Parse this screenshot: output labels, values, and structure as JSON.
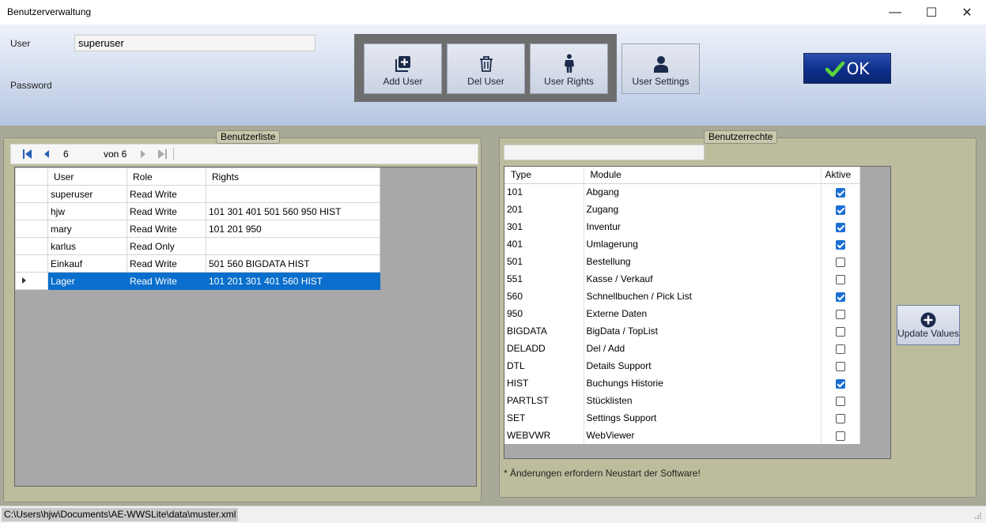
{
  "window": {
    "title": "Benutzerverwaltung",
    "minimize": "—",
    "maximize": "☐",
    "close": "✕"
  },
  "login": {
    "user_label": "User",
    "user_value": "superuser",
    "password_label": "Password"
  },
  "toolbar": {
    "add_user": "Add User",
    "del_user": "Del User",
    "user_rights": "User Rights",
    "user_settings": "User Settings",
    "ok": "OK"
  },
  "userlist": {
    "group_label": "Benutzerliste",
    "nav": {
      "position": "6",
      "of_label": "von 6"
    },
    "columns": [
      "User",
      "Role",
      "Rights"
    ],
    "rows": [
      {
        "user": "superuser",
        "role": "Read Write",
        "rights": ""
      },
      {
        "user": "hjw",
        "role": "Read Write",
        "rights": "101 301 401 501 560 950 HIST"
      },
      {
        "user": "mary",
        "role": "Read Write",
        "rights": "101 201 950"
      },
      {
        "user": "karlus",
        "role": "Read Only",
        "rights": ""
      },
      {
        "user": "Einkauf",
        "role": "Read Write",
        "rights": "501 560 BIGDATA HIST"
      },
      {
        "user": "Lager",
        "role": "Read Write",
        "rights": "101 201 301 401 560 HIST"
      }
    ]
  },
  "rights": {
    "group_label": "Benutzerrechte",
    "columns": [
      "Type",
      "Module",
      "Aktive"
    ],
    "rows": [
      {
        "type": "101",
        "module": "Abgang",
        "active": true
      },
      {
        "type": "201",
        "module": "Zugang",
        "active": true
      },
      {
        "type": "301",
        "module": "Inventur",
        "active": true
      },
      {
        "type": "401",
        "module": "Umlagerung",
        "active": true
      },
      {
        "type": "501",
        "module": "Bestellung",
        "active": false
      },
      {
        "type": "551",
        "module": "Kasse / Verkauf",
        "active": false
      },
      {
        "type": "560",
        "module": "Schnellbuchen / Pick List",
        "active": true
      },
      {
        "type": "950",
        "module": "Externe Daten",
        "active": false
      },
      {
        "type": "BIGDATA",
        "module": "BigData / TopList",
        "active": false
      },
      {
        "type": "DELADD",
        "module": "Del / Add",
        "active": false
      },
      {
        "type": "DTL",
        "module": "Details Support",
        "active": false
      },
      {
        "type": "HIST",
        "module": "Buchungs Historie",
        "active": true
      },
      {
        "type": "PARTLST",
        "module": "Stücklisten",
        "active": false
      },
      {
        "type": "SET",
        "module": "Settings Support",
        "active": false
      },
      {
        "type": "WEBVWR",
        "module": "WebViewer",
        "active": false
      }
    ],
    "update_button": "Update Values",
    "note": "* Änderungen erfordern Neustart der Software!"
  },
  "status": {
    "path": "C:\\Users\\hjw\\Documents\\AE-WWSLite\\data\\muster.xml"
  },
  "colors": {
    "selection": "#0a6fcc",
    "checkbox_checked": "#1a6fd4",
    "ok_button": "#0e2f8a"
  }
}
